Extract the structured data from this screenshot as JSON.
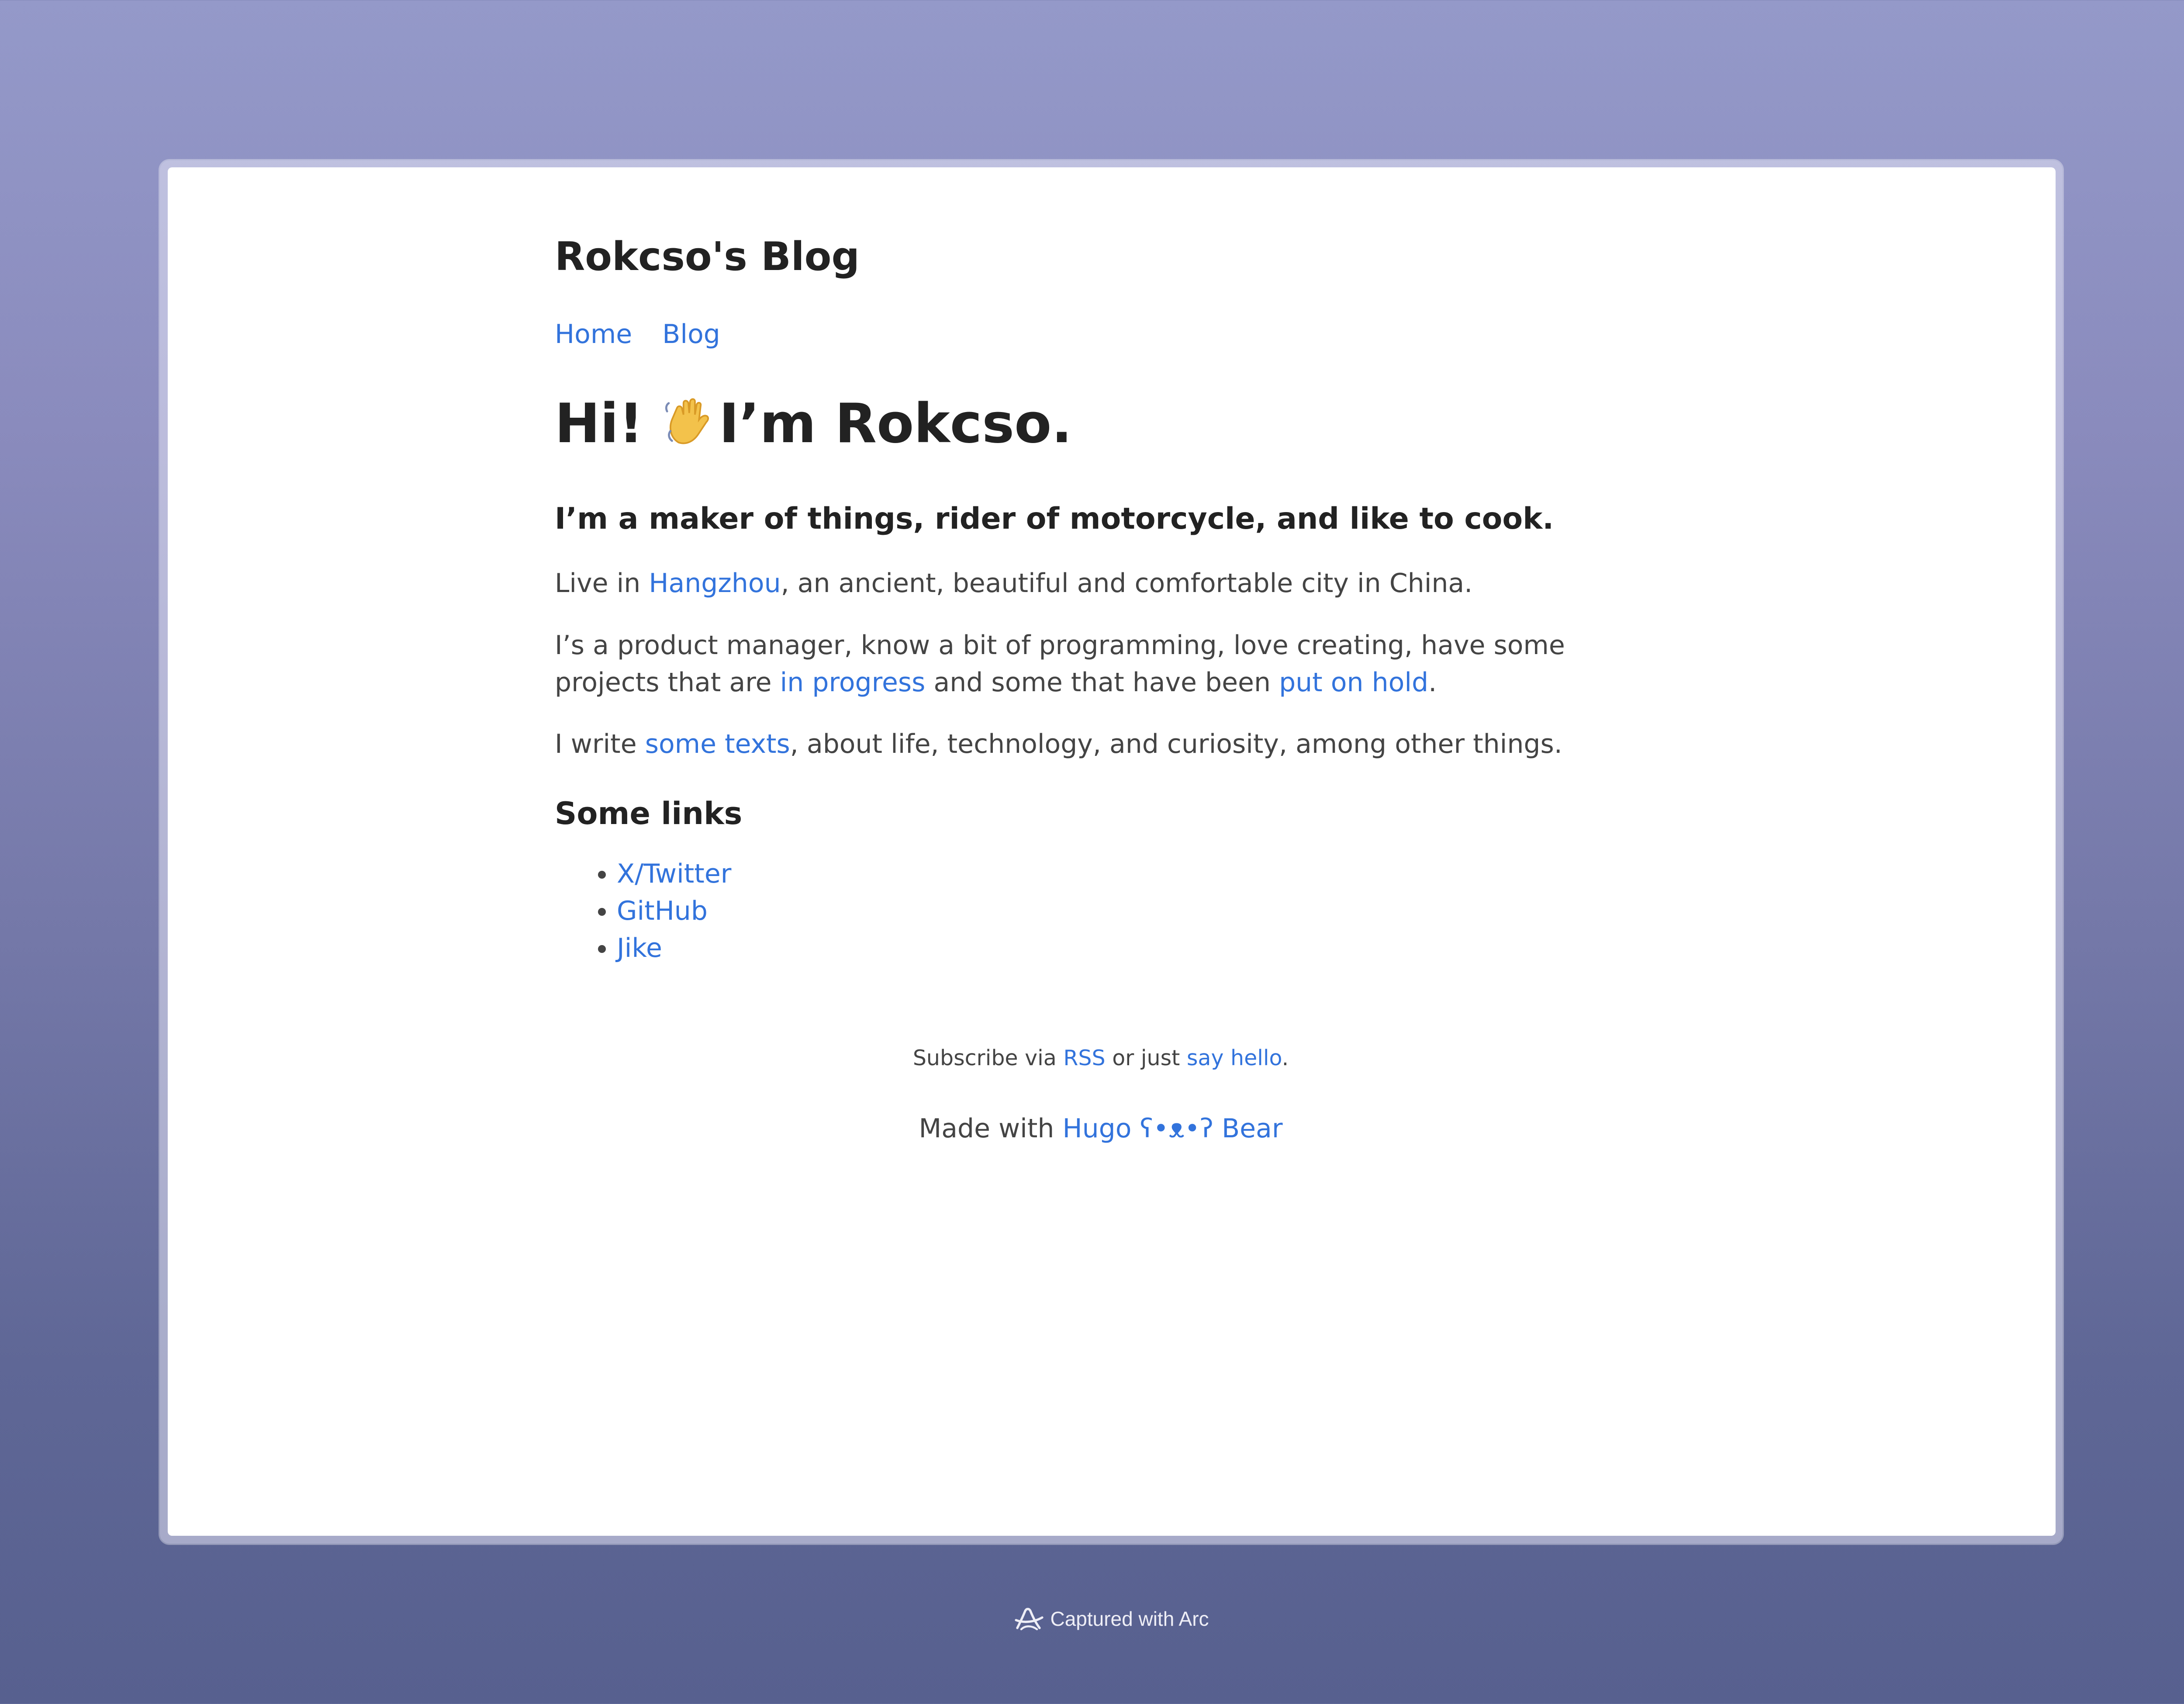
{
  "site": {
    "title": "Rokcso's Blog",
    "nav": [
      "Home",
      "Blog"
    ]
  },
  "hero": {
    "before_emoji": "Hi!",
    "emoji_icon": "waving-hand-icon",
    "after_emoji": "I’m Rokcso."
  },
  "subhead": "I’m a maker of things, rider of motorcycle, and like to cook.",
  "p1": {
    "before": "Live in ",
    "link": "Hangzhou",
    "after": ", an ancient, beautiful and comfortable city in China."
  },
  "p2": {
    "before": "I’s a product manager, know a bit of programming, love creating, have some projects that are ",
    "link1": "in progress",
    "middle": " and some that have been ",
    "link2": "put on hold",
    "after": "."
  },
  "p3": {
    "before": "I write ",
    "link": "some texts",
    "after": ", about life, technology, and curiosity, among other things."
  },
  "links_section": {
    "title": "Some links",
    "items": [
      "X/Twitter",
      "GitHub",
      "Jike"
    ]
  },
  "footer": {
    "subscribe_before": "Subscribe via ",
    "rss": "RSS",
    "subscribe_middle": " or just ",
    "say_hello": "say hello",
    "subscribe_after": ".",
    "made_with": "Made with ",
    "hugo_bear": "Hugo ʕ•ᴥ•ʔ Bear"
  },
  "arc": {
    "caption": "Captured with Arc",
    "icon": "arc-logo-icon"
  },
  "colors": {
    "link": "#3273dc",
    "heading": "#222222",
    "text": "#444444"
  }
}
